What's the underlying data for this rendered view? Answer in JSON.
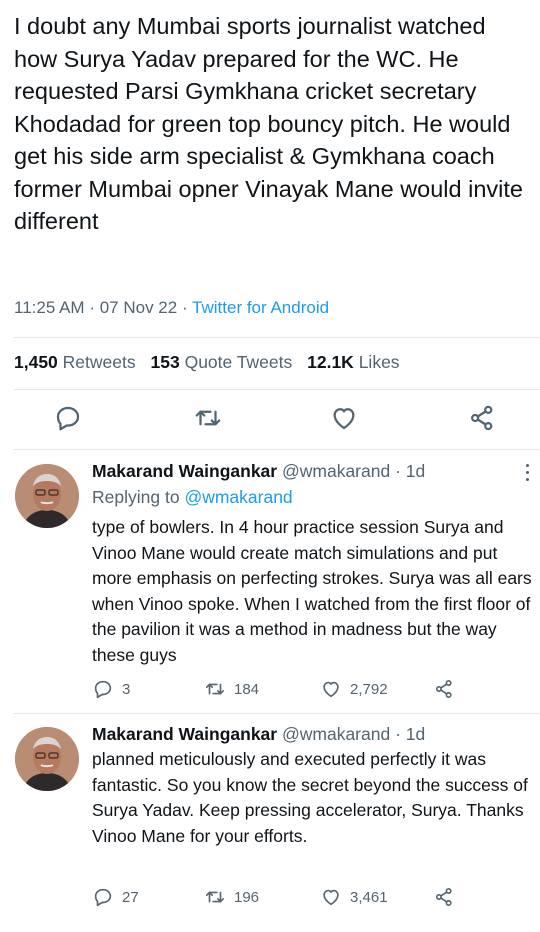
{
  "tweet": {
    "text": "I doubt any Mumbai sports journalist watched how  Surya Yadav prepared for the WC. He  requested Parsi Gymkhana cricket secretary Khodadad for green top bouncy pitch. He would get his side arm specialist & Gymkhana coach former Mumbai opner Vinayak Mane would invite different",
    "time": "11:25 AM",
    "date": "07 Nov 22",
    "source": "Twitter for Android",
    "sep": "·"
  },
  "stats": {
    "retweets_count": "1,450",
    "retweets_label": "Retweets",
    "quotes_count": "153",
    "quotes_label": "Quote Tweets",
    "likes_count": "12.1K",
    "likes_label": "Likes"
  },
  "icons": {
    "reply": "reply-icon",
    "retweet": "retweet-icon",
    "like": "heart-icon",
    "share": "share-icon",
    "more": "more-icon"
  },
  "replies": [
    {
      "name": "Makarand Waingankar",
      "handle": "@wmakarand",
      "age": "· 1d",
      "replying_prefix": "Replying to",
      "replying_handle": "@wmakarand",
      "text": "type of bowlers. In 4 hour practice session Surya and Vinoo Mane would create match simulations and put more emphasis on perfecting strokes. Surya was all ears when Vinoo spoke. When I watched from the first floor of the pavilion it was a method in madness but the way these guys",
      "reply_count": "3",
      "retweet_count": "184",
      "like_count": "2,792"
    },
    {
      "name": "Makarand Waingankar",
      "handle": "@wmakarand",
      "age": "· 1d",
      "text": "planned meticulously and executed perfectly it was fantastic. So you know the secret beyond the success of Surya Yadav. Keep pressing accelerator, Surya. Thanks Vinoo Mane for your efforts.",
      "reply_count": "27",
      "retweet_count": "196",
      "like_count": "3,461"
    }
  ],
  "colors": {
    "text": "#0f1419",
    "muted": "#536471",
    "link": "#1d9bf0",
    "divider": "#e4e8eb"
  }
}
